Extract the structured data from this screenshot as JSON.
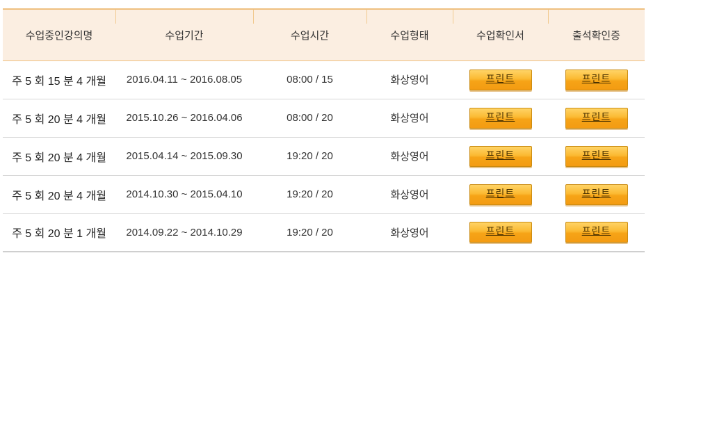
{
  "table": {
    "headers": [
      "수업중인강의명",
      "수업기간",
      "수업시간",
      "수업형태",
      "수업확인서",
      "출석확인증"
    ],
    "rows": [
      {
        "course": "주 5 회 15 분 4 개월",
        "period": "2016.04.11 ~ 2016.08.05",
        "time": "08:00 / 15",
        "type": "화상영어",
        "confirm": "프린트",
        "attendance": "프린트"
      },
      {
        "course": "주 5 회 20 분 4 개월",
        "period": "2015.10.26 ~ 2016.04.06",
        "time": "08:00 / 20",
        "type": "화상영어",
        "confirm": "프린트",
        "attendance": "프린트"
      },
      {
        "course": "주 5 회 20 분 4 개월",
        "period": "2015.04.14 ~ 2015.09.30",
        "time": "19:20 / 20",
        "type": "화상영어",
        "confirm": "프린트",
        "attendance": "프린트"
      },
      {
        "course": "주 5 회 20 분 4 개월",
        "period": "2014.10.30 ~ 2015.04.10",
        "time": "19:20 / 20",
        "type": "화상영어",
        "confirm": "프린트",
        "attendance": "프린트"
      },
      {
        "course": "주 5 회 20 분 1 개월",
        "period": "2014.09.22 ~ 2014.10.29",
        "time": "19:20 / 20",
        "type": "화상영어",
        "confirm": "프린트",
        "attendance": "프린트"
      }
    ]
  },
  "colors": {
    "header_bg": "#fbeee1",
    "header_border": "#efbf7f",
    "button_orange": "#f6a417",
    "row_divider": "#d5d5d5"
  }
}
